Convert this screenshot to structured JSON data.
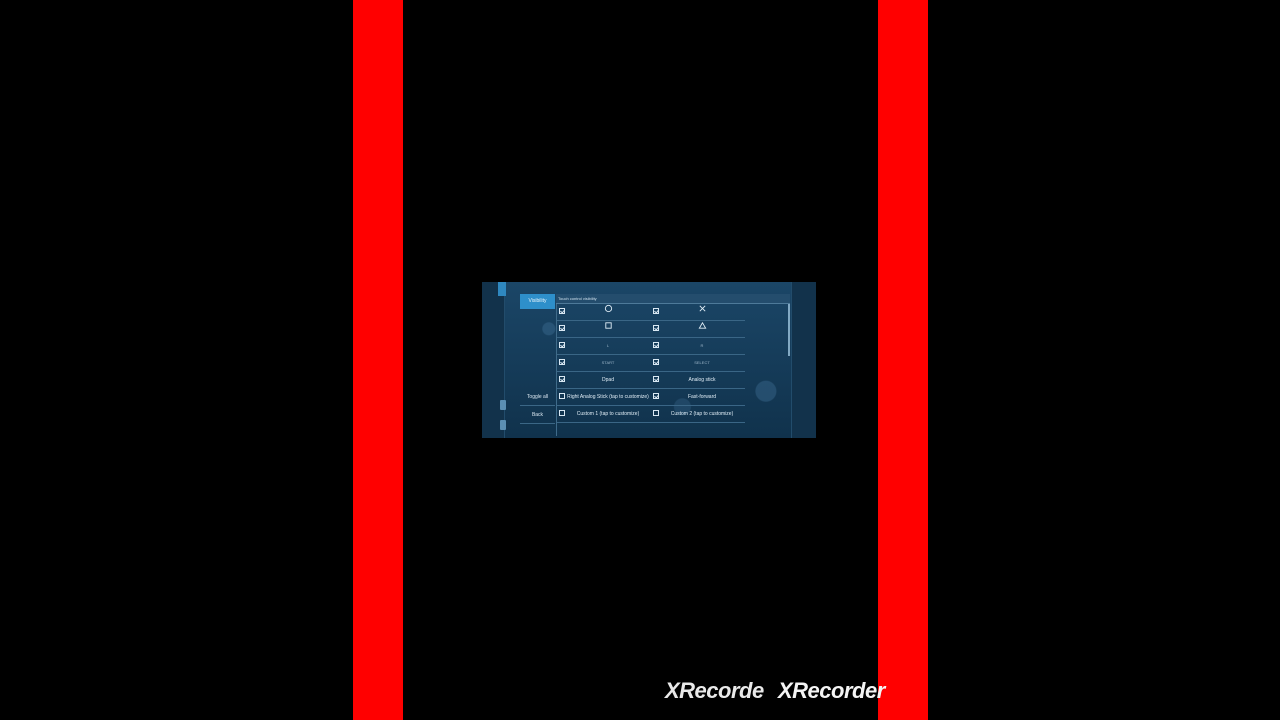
{
  "screen": {
    "side_menu": {
      "active_tab": "Visibility",
      "buttons": [
        "Toggle all",
        "Back"
      ]
    },
    "panel_title": "Touch control visibility",
    "rows": [
      {
        "left": {
          "checked": true,
          "label": "○",
          "kind": "circle-icon"
        },
        "right": {
          "checked": true,
          "label": "✕",
          "kind": "cross-icon"
        }
      },
      {
        "left": {
          "checked": true,
          "label": "□",
          "kind": "square-icon"
        },
        "right": {
          "checked": true,
          "label": "△",
          "kind": "triangle-icon"
        }
      },
      {
        "left": {
          "checked": true,
          "label": "L",
          "kind": "text"
        },
        "right": {
          "checked": true,
          "label": "R",
          "kind": "text"
        }
      },
      {
        "left": {
          "checked": true,
          "label": "START",
          "kind": "text"
        },
        "right": {
          "checked": true,
          "label": "SELECT",
          "kind": "text"
        }
      },
      {
        "left": {
          "checked": true,
          "label": "Dpad",
          "kind": "text"
        },
        "right": {
          "checked": true,
          "label": "Analog stick",
          "kind": "text"
        }
      },
      {
        "left": {
          "checked": false,
          "label": "Right Analog Stick (tap to customize)",
          "kind": "text"
        },
        "right": {
          "checked": true,
          "label": "Fast-forward",
          "kind": "text"
        }
      },
      {
        "left": {
          "checked": false,
          "label": "Custom 1 (tap to customize)",
          "kind": "text"
        },
        "right": {
          "checked": false,
          "label": "Custom 2 (tap to customize)",
          "kind": "text"
        }
      }
    ]
  },
  "watermark": {
    "part1": "XRecorde",
    "part2": "XRecorder"
  },
  "colors": {
    "side_bars": "#ff0000",
    "accent": "#2e8fca",
    "panel_bg": "#163a55"
  }
}
